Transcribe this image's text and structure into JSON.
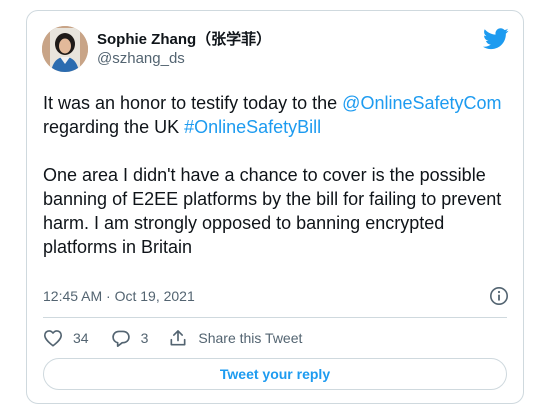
{
  "author": {
    "name": "Sophie Zhang",
    "name_cjk": "（张学菲）",
    "handle": "@szhang_ds"
  },
  "tweet": {
    "line1_text": "It was an honor to testify today to the ",
    "mention": "@OnlineSafetyCom",
    "line2_text": " regarding the UK ",
    "hashtag": "#OnlineSafetyBill",
    "paragraph2": "One area I didn't have a chance to cover is the possible banning of E2EE platforms by the bill for failing to prevent harm. I am strongly opposed to banning encrypted platforms in Britain"
  },
  "meta": {
    "timestamp": "12:45 AM · Oct 19, 2021"
  },
  "actions": {
    "like_count": "34",
    "reply_count": "3",
    "share_label": "Share this Tweet"
  },
  "reply_button_label": "Tweet your reply",
  "icons": {
    "brand": "twitter-bird-icon",
    "info": "info-icon",
    "like": "heart-icon",
    "reply": "speech-bubble-icon",
    "share": "share-arrow-icon"
  },
  "colors": {
    "accent": "#1d9bf0",
    "text": "#0f1419",
    "muted": "#536471",
    "border": "#cfd9de"
  }
}
